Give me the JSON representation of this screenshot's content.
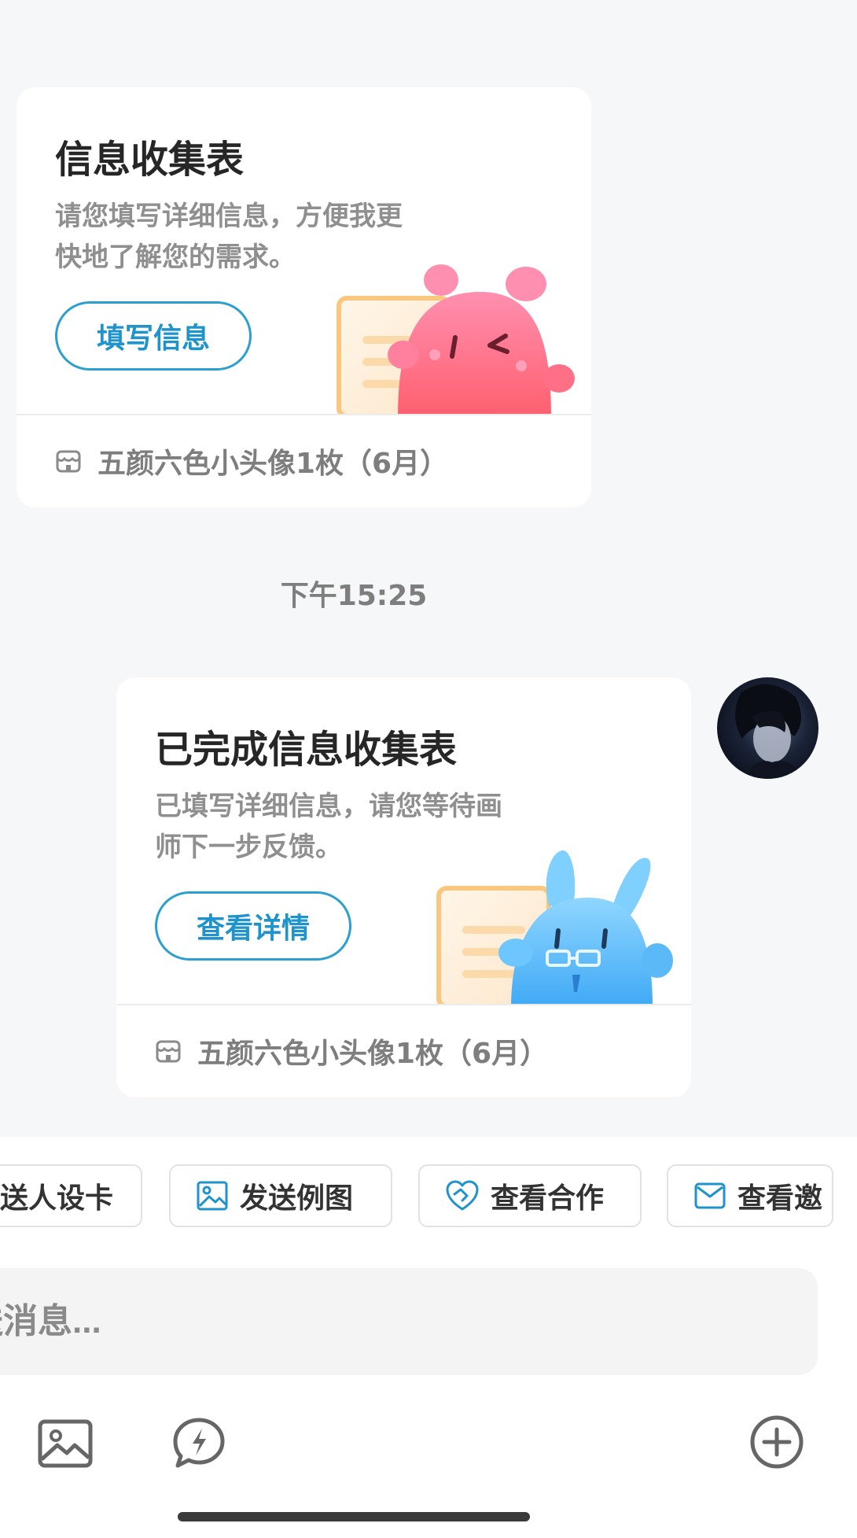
{
  "cards": [
    {
      "title": "信息收集表",
      "desc": "请您填写详细信息，方便我更快地了解您的需求。",
      "button": "填写信息",
      "footer": "五颜六色小头像1枚（6月）",
      "mascot": "pink-mascot-icon"
    },
    {
      "title": "已完成信息收集表",
      "desc": "已填写详细信息，请您等待画师下一步反馈。",
      "button": "查看详情",
      "footer": "五颜六色小头像1枚（6月）",
      "mascot": "blue-rabbit-mascot-icon"
    }
  ],
  "timestamp": "下午15:25",
  "quick_actions": [
    {
      "label": "送人设卡",
      "icon": "id-card-icon"
    },
    {
      "label": "发送例图",
      "icon": "image-icon"
    },
    {
      "label": "查看合作",
      "icon": "handshake-heart-icon"
    },
    {
      "label": "查看邀",
      "icon": "mail-icon"
    }
  ],
  "input": {
    "placeholder": "送消息..."
  },
  "toolbar": {
    "icons": [
      "image-icon",
      "lightning-chat-icon",
      "plus-circle-icon"
    ]
  },
  "colors": {
    "accent": "#1f93cb",
    "background": "#f6f7f9"
  }
}
